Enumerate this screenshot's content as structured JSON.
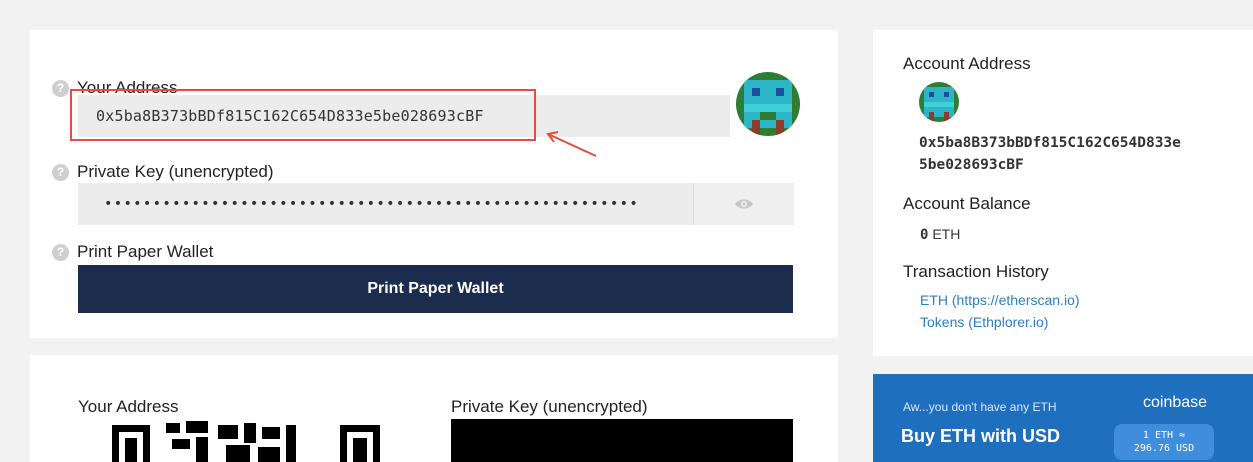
{
  "wallet": {
    "address_label": "Your Address",
    "address_value": "0x5ba8B373bBDf815C162C654D833e5be028693cBF",
    "private_key_label": "Private Key (unencrypted)",
    "private_key_masked": "•••••••••••••••••••••••••••••••••••••••••••••••••••••••",
    "print_label": "Print Paper Wallet",
    "print_button": "Print Paper Wallet",
    "help_glyph": "?"
  },
  "account": {
    "address_heading": "Account Address",
    "address_line1": "0x5ba8B373bBDf815C162C654D833e",
    "address_line2": "5be028693cBF",
    "balance_heading": "Account Balance",
    "balance_value": "0",
    "balance_unit": "ETH",
    "history_heading": "Transaction History",
    "links": [
      "ETH (https://etherscan.io)",
      "Tokens (Ethplorer.io)"
    ]
  },
  "paper": {
    "address_label": "Your Address",
    "private_key_label": "Private Key (unencrypted)"
  },
  "coinbase": {
    "subtitle": "Aw...you don't have any ETH",
    "title": "Buy ETH with USD",
    "brand": "coinbase",
    "rate_line1": "1 ETH ≈",
    "rate_line2": "296.76 USD"
  },
  "colors": {
    "primary_button": "#1b2c4f",
    "highlight": "#e74c3c",
    "link": "#2b7fc3",
    "coinbase_blue": "#1f6fbf"
  },
  "icons": {
    "help": "help-circle-icon",
    "eye": "eye-icon",
    "identicon": "identicon",
    "arrow": "red-arrow-annotation"
  }
}
